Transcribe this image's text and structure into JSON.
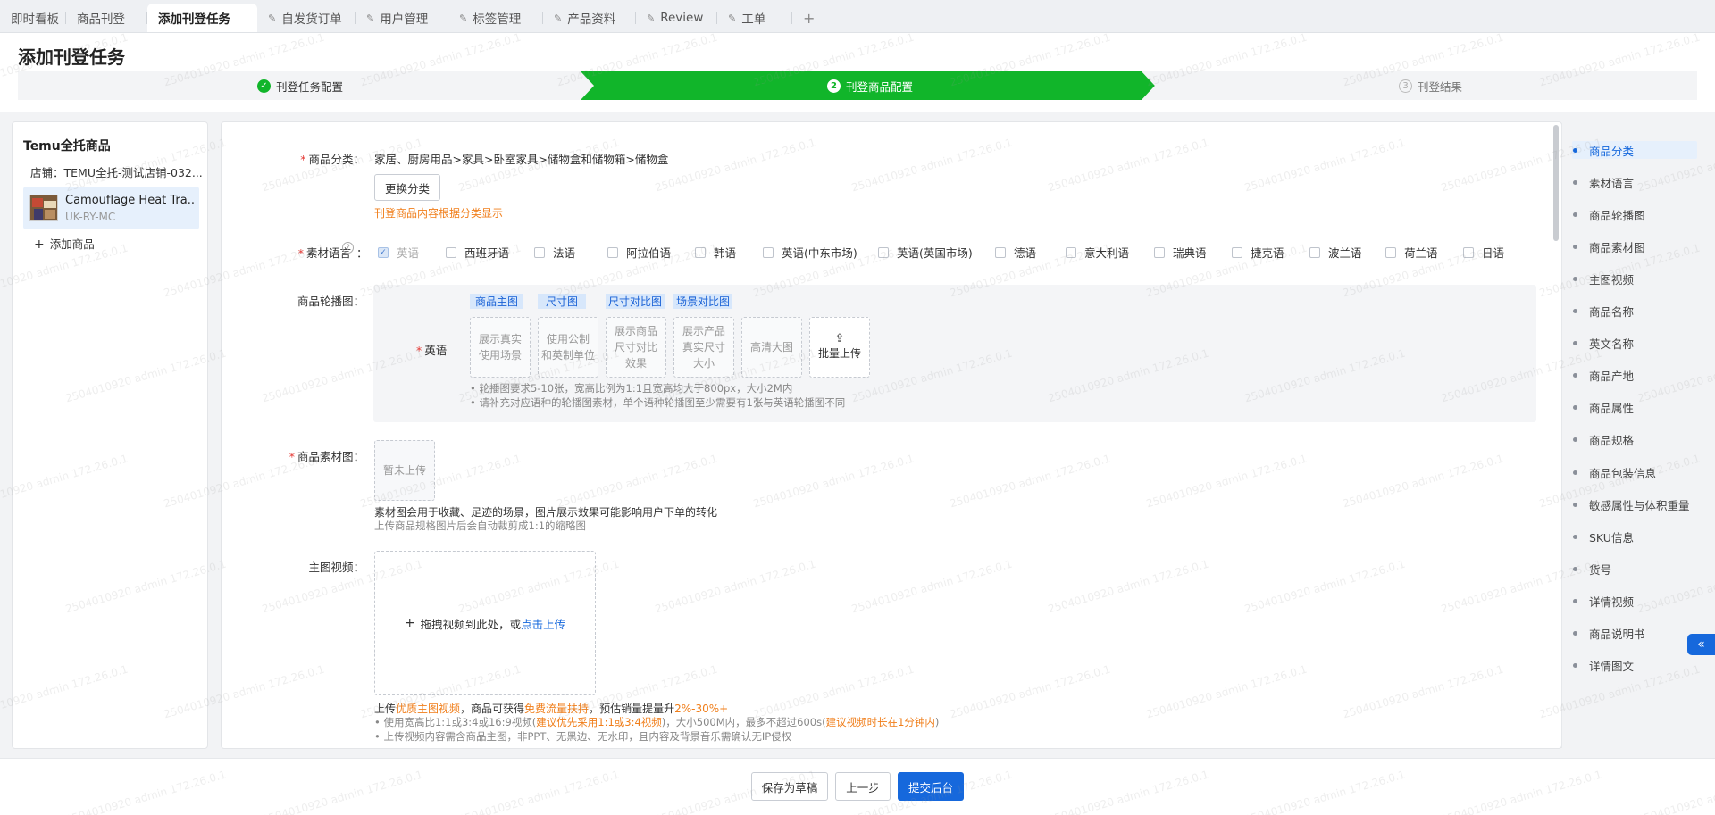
{
  "tabs": [
    {
      "label": "即时看板",
      "pinned": false,
      "active": false
    },
    {
      "label": "商品刊登",
      "pinned": false,
      "active": false
    },
    {
      "label": "添加刊登任务",
      "pinned": false,
      "active": true
    },
    {
      "label": "自发货订单",
      "pinned": true,
      "active": false
    },
    {
      "label": "用户管理",
      "pinned": true,
      "active": false
    },
    {
      "label": "标签管理",
      "pinned": true,
      "active": false
    },
    {
      "label": "产品资料",
      "pinned": true,
      "active": false
    },
    {
      "label": "Review",
      "pinned": true,
      "active": false
    },
    {
      "label": "工单",
      "pinned": true,
      "active": false
    }
  ],
  "add_tab_label": "+",
  "page_title": "添加刊登任务",
  "steps": [
    {
      "index": "✓",
      "label": "刊登任务配置",
      "status": "done"
    },
    {
      "index": "2",
      "label": "刊登商品配置",
      "status": "active"
    },
    {
      "index": "3",
      "label": "刊登结果",
      "status": "pending"
    }
  ],
  "left_panel": {
    "title": "Temu全托商品",
    "store": "店铺：TEMU全托-测试店铺-032...",
    "product_name": "Camouflage Heat Tra...",
    "product_sku": "UK-RY-MC",
    "add_product": "添加商品"
  },
  "form": {
    "category": {
      "label": "商品分类：",
      "value": "家居、厨房用品>家具>卧室家具>储物盒和储物箱>储物盒",
      "change_button": "更换分类",
      "hint": "刊登商品内容根据分类显示"
    },
    "material_language": {
      "label": "素材语言",
      "options": [
        {
          "label": "英语",
          "checked": true,
          "disabled": true
        },
        {
          "label": "西班牙语",
          "checked": false
        },
        {
          "label": "法语",
          "checked": false
        },
        {
          "label": "阿拉伯语",
          "checked": false
        },
        {
          "label": "韩语",
          "checked": false
        },
        {
          "label": "英语(中东市场)",
          "checked": false
        },
        {
          "label": "英语(英国市场)",
          "checked": false
        },
        {
          "label": "德语",
          "checked": false
        },
        {
          "label": "意大利语",
          "checked": false
        },
        {
          "label": "瑞典语",
          "checked": false
        },
        {
          "label": "捷克语",
          "checked": false
        },
        {
          "label": "波兰语",
          "checked": false
        },
        {
          "label": "荷兰语",
          "checked": false
        },
        {
          "label": "日语",
          "checked": false
        }
      ]
    },
    "carousel": {
      "label": "商品轮播图：",
      "row_label": "英语",
      "tags": [
        "商品主图",
        "尺寸图",
        "尺寸对比图",
        "场景对比图"
      ],
      "slots": [
        "展示真实使用场景",
        "使用公制和英制单位",
        "展示商品尺寸对比效果",
        "展示产品真实尺寸大小",
        "高清大图"
      ],
      "slot_lines": [
        [
          "展示真实",
          "使用场景"
        ],
        [
          "使用公制",
          "和英制单位"
        ],
        [
          "展示商品",
          "尺寸对比",
          "效果"
        ],
        [
          "展示产品",
          "真实尺寸",
          "大小"
        ],
        [
          "高清大图"
        ]
      ],
      "bulk_upload": "批量上传",
      "notes": [
        "轮播图要求5-10张，宽高比例为1:1且宽高均大于800px，大小2M内",
        "请补充对应语种的轮播图素材，单个语种轮播图至少需要有1张与英语轮播图不同"
      ]
    },
    "material_image": {
      "label": "商品素材图：",
      "placeholder": "暂未上传",
      "desc": "素材图会用于收藏、足迹的场景，图片展示效果可能影响用户下单的转化",
      "sub": "上传商品规格图片后会自动裁剪成1:1的缩略图"
    },
    "main_video": {
      "label": "主图视频：",
      "drop_text": "拖拽视频到此处，或",
      "upload_link": "点击上传",
      "promo_pre": "上传",
      "promo_hl1": "优质主图视频",
      "promo_mid": "，商品可获得",
      "promo_hl2": "免费流量扶持",
      "promo_mid2": "，预估销量提量升",
      "promo_hl3": "2%-30%+",
      "rule1_pre": "使用宽高比1:1或3:4或16:9视频(",
      "rule1_hl": "建议优先采用1:1或3:4视频",
      "rule1_mid": ")，大小500M内，最多不超过600s(",
      "rule1_hl2": "建议视频时长在1分钟内",
      "rule1_end": ")",
      "rule2": "上传视频内容需含商品主图，非PPT、无黑边、无水印，且内容及背景音乐需确认无IP侵权"
    }
  },
  "anchors": [
    "商品分类",
    "素材语言",
    "商品轮播图",
    "商品素材图",
    "主图视频",
    "商品名称",
    "英文名称",
    "商品产地",
    "商品属性",
    "商品规格",
    "商品包装信息",
    "敏感属性与体积重量",
    "SKU信息",
    "货号",
    "详情视频",
    "商品说明书",
    "详情图文"
  ],
  "collapse_icon": "«",
  "footer": {
    "save_draft": "保存为草稿",
    "prev": "上一步",
    "submit": "提交后台"
  },
  "watermark": "2504010920 admin 172.26.0.1",
  "colors": {
    "accent": "#1668dc",
    "step_active": "#11b52a",
    "warning": "#f07e1a",
    "required": "#e53935"
  }
}
